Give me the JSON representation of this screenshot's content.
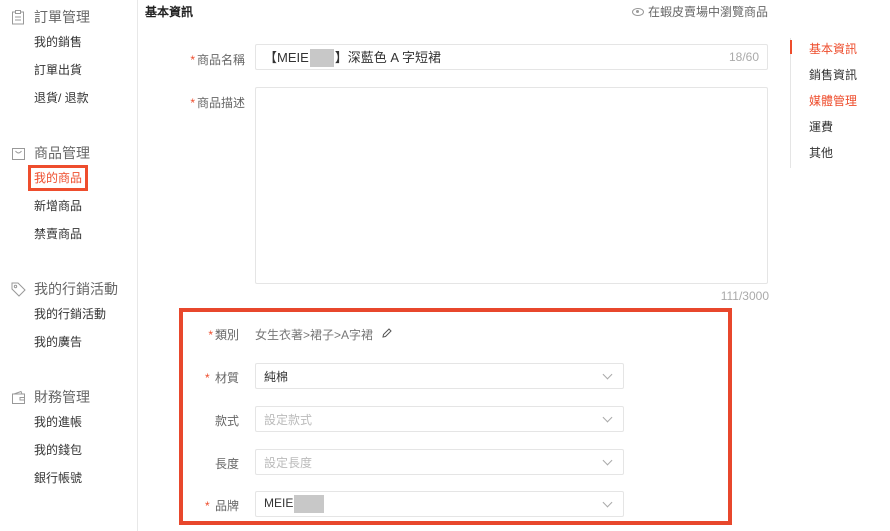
{
  "sidebar": {
    "groups": [
      {
        "title": "訂單管理",
        "icon": "clipboard-icon",
        "items": [
          "我的銷售",
          "訂單出貨",
          "退貨/ 退款"
        ]
      },
      {
        "title": "商品管理",
        "icon": "shopping-bag-icon",
        "items": [
          "我的商品",
          "新增商品",
          "禁賣商品"
        ]
      },
      {
        "title": "我的行銷活動",
        "icon": "tag-icon",
        "items": [
          "我的行銷活動",
          "我的廣告"
        ]
      },
      {
        "title": "財務管理",
        "icon": "wallet-icon",
        "items": [
          "我的進帳",
          "我的錢包",
          "銀行帳號"
        ]
      }
    ],
    "active_item": "我的商品"
  },
  "main": {
    "section_title": "基本資訊",
    "preview_link": "在蝦皮賣場中瀏覽商品",
    "name_field": {
      "label": "商品名稱",
      "value_prefix": "【MEIE",
      "value_suffix": "】深藍色 A 字短裙",
      "counter": "18/60"
    },
    "description_field": {
      "label": "商品描述",
      "counter": "111/3000"
    },
    "category": {
      "label": "類別",
      "value": "女生衣著>裙子>A字裙"
    },
    "material": {
      "label": "材質",
      "value": "純棉"
    },
    "style": {
      "label": "款式",
      "placeholder": "設定款式"
    },
    "length": {
      "label": "長度",
      "placeholder": "設定長度"
    },
    "brand": {
      "label": "品牌",
      "value_prefix": "MEIE"
    },
    "required_mark": "*"
  },
  "anchor_nav": {
    "items": [
      "基本資訊",
      "銷售資訊",
      "媒體管理",
      "運費",
      "其他"
    ]
  },
  "colors": {
    "accent": "#ee4d2d",
    "highlight_border": "#e8472c"
  }
}
